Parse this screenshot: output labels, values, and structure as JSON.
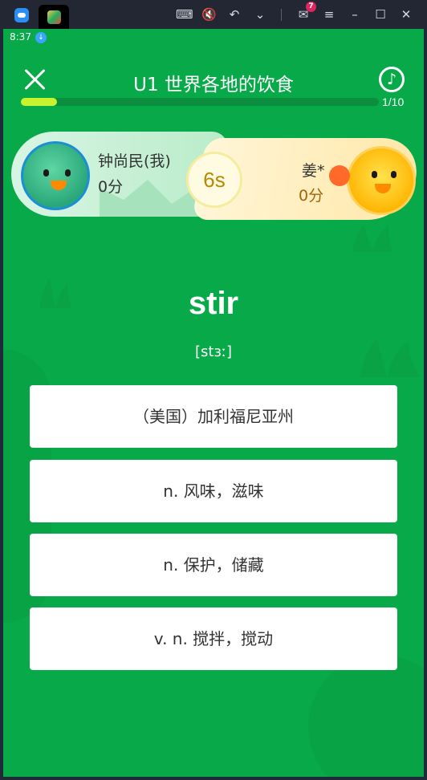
{
  "emulator": {
    "icons": [
      "app-logo",
      "game-tab-icon",
      "keyboard-icon",
      "volume-mute-icon",
      "undo-icon",
      "chevron-down-icon",
      "mail-icon",
      "menu-icon",
      "minimize-icon",
      "maximize-icon",
      "close-icon"
    ],
    "mail_badge": "7"
  },
  "status": {
    "time": "8:37"
  },
  "header": {
    "title": "U1 世界各地的饮食"
  },
  "progress": {
    "text": "1/10",
    "fraction": 0.1
  },
  "players": {
    "me": {
      "name": "钟尚民(我)",
      "score": "0分"
    },
    "opponent": {
      "name": "姜*",
      "score": "0分"
    }
  },
  "timer": "6s",
  "question": {
    "word": "stir",
    "phonetic": "[stɜː]"
  },
  "options": [
    {
      "label": "（美国）加利福尼亚州"
    },
    {
      "label": "n. 风味，滋味"
    },
    {
      "label": "n. 保护，储藏"
    },
    {
      "label": "v. n. 搅拌，搅动"
    }
  ],
  "colors": {
    "screen_bg": "#07a948",
    "progress_fill": "#c6f530",
    "score_me": "#333333",
    "score_opponent": "#a0660a"
  }
}
